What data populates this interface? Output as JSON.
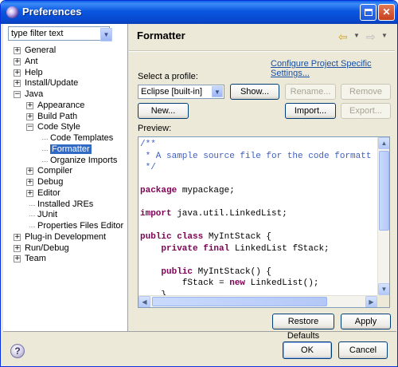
{
  "window": {
    "title": "Preferences"
  },
  "filter": {
    "placeholder": "type filter text"
  },
  "tree": [
    {
      "label": "General",
      "toggle": "+",
      "level": 0
    },
    {
      "label": "Ant",
      "toggle": "+",
      "level": 0
    },
    {
      "label": "Help",
      "toggle": "+",
      "level": 0
    },
    {
      "label": "Install/Update",
      "toggle": "+",
      "level": 0
    },
    {
      "label": "Java",
      "toggle": "-",
      "level": 0
    },
    {
      "label": "Appearance",
      "toggle": "+",
      "level": 1
    },
    {
      "label": "Build Path",
      "toggle": "+",
      "level": 1
    },
    {
      "label": "Code Style",
      "toggle": "-",
      "level": 1
    },
    {
      "label": "Code Templates",
      "toggle": "",
      "level": 2
    },
    {
      "label": "Formatter",
      "toggle": "",
      "level": 2,
      "selected": true
    },
    {
      "label": "Organize Imports",
      "toggle": "",
      "level": 2
    },
    {
      "label": "Compiler",
      "toggle": "+",
      "level": 1
    },
    {
      "label": "Debug",
      "toggle": "+",
      "level": 1
    },
    {
      "label": "Editor",
      "toggle": "+",
      "level": 1
    },
    {
      "label": "Installed JREs",
      "toggle": "",
      "level": 1
    },
    {
      "label": "JUnit",
      "toggle": "",
      "level": 1
    },
    {
      "label": "Properties Files Editor",
      "toggle": "",
      "level": 1
    },
    {
      "label": "Plug-in Development",
      "toggle": "+",
      "level": 0
    },
    {
      "label": "Run/Debug",
      "toggle": "+",
      "level": 0
    },
    {
      "label": "Team",
      "toggle": "+",
      "level": 0
    }
  ],
  "page": {
    "title": "Formatter",
    "configure_link": "Configure Project Specific Settings...",
    "profile_label": "Select a profile:",
    "profile_value": "Eclipse [built-in]",
    "buttons": {
      "show": "Show...",
      "rename": "Rename...",
      "remove": "Remove",
      "new": "New...",
      "import": "Import...",
      "export": "Export..."
    },
    "preview_label": "Preview:",
    "code": [
      [
        {
          "t": "/**",
          "c": "cm"
        }
      ],
      [
        {
          "t": " * A sample source file for the code formatt",
          "c": "cm"
        }
      ],
      [
        {
          "t": " */",
          "c": "cm"
        }
      ],
      [],
      [
        {
          "t": "package",
          "c": "kw"
        },
        {
          "t": " mypackage;",
          "c": ""
        }
      ],
      [],
      [
        {
          "t": "import",
          "c": "kw"
        },
        {
          "t": " java.util.LinkedList;",
          "c": ""
        }
      ],
      [],
      [
        {
          "t": "public class",
          "c": "kw"
        },
        {
          "t": " MyIntStack {",
          "c": ""
        }
      ],
      [
        {
          "t": "    ",
          "c": ""
        },
        {
          "t": "private final",
          "c": "kw"
        },
        {
          "t": " LinkedList fStack;",
          "c": ""
        }
      ],
      [],
      [
        {
          "t": "    ",
          "c": ""
        },
        {
          "t": "public",
          "c": "kw"
        },
        {
          "t": " MyIntStack() {",
          "c": ""
        }
      ],
      [
        {
          "t": "        fStack = ",
          "c": ""
        },
        {
          "t": "new",
          "c": "kw"
        },
        {
          "t": " LinkedList();",
          "c": ""
        }
      ],
      [
        {
          "t": "    }",
          "c": ""
        }
      ]
    ]
  },
  "actions": {
    "restore_defaults": "Restore Defaults",
    "apply": "Apply",
    "ok": "OK",
    "cancel": "Cancel"
  },
  "icons": {
    "back": "back-arrow-icon",
    "forward": "forward-arrow-icon",
    "help": "help-icon"
  }
}
